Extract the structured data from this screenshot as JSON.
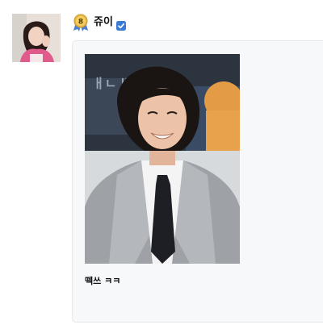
{
  "author": {
    "name": "쥬이",
    "level": "8",
    "verified": true
  },
  "post": {
    "caption": "떽쓰 ㅋㅋ"
  },
  "colors": {
    "verified_badge": "#3a7bd5",
    "level_badge_gold": "#e8b84a",
    "card_background": "#f7f8fa",
    "card_border": "#e6e8eb",
    "text_primary": "#111111"
  },
  "icons": {
    "level": "level-badge-icon",
    "verified": "verified-check-icon"
  },
  "background_sign_text": "ㅐㄴ 베니"
}
